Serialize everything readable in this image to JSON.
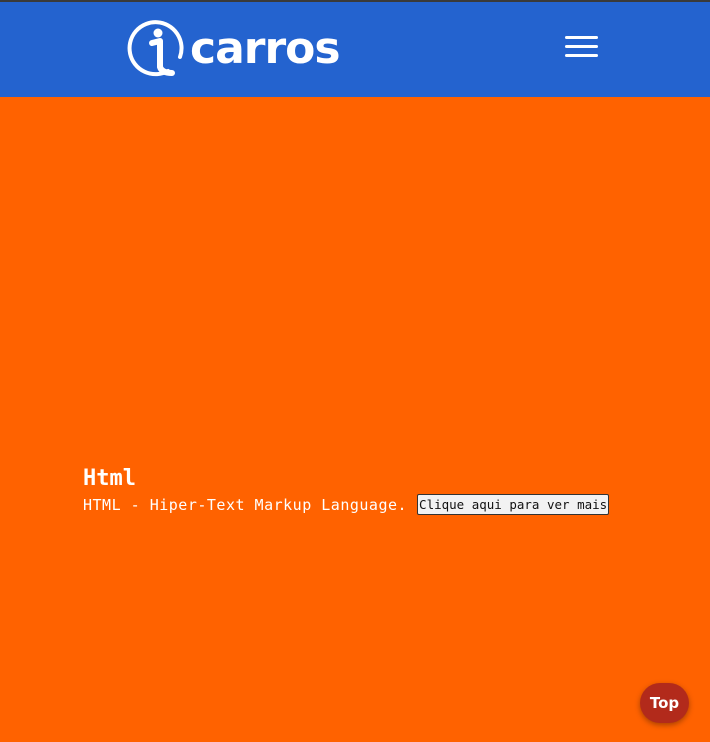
{
  "header": {
    "logo_text": "carros",
    "logo_icon": "icarros-i-logo-icon",
    "menu_icon": "hamburger-menu-icon"
  },
  "content": {
    "title": "Html",
    "description": "HTML - Hiper-Text Markup Language.",
    "more_button_label": "Clique aqui para ver mais"
  },
  "back_to_top": {
    "label": "Top"
  },
  "colors": {
    "header_bg": "#2463cf",
    "page_bg": "#ff6200",
    "top_button_bg": "#b22a1b"
  }
}
